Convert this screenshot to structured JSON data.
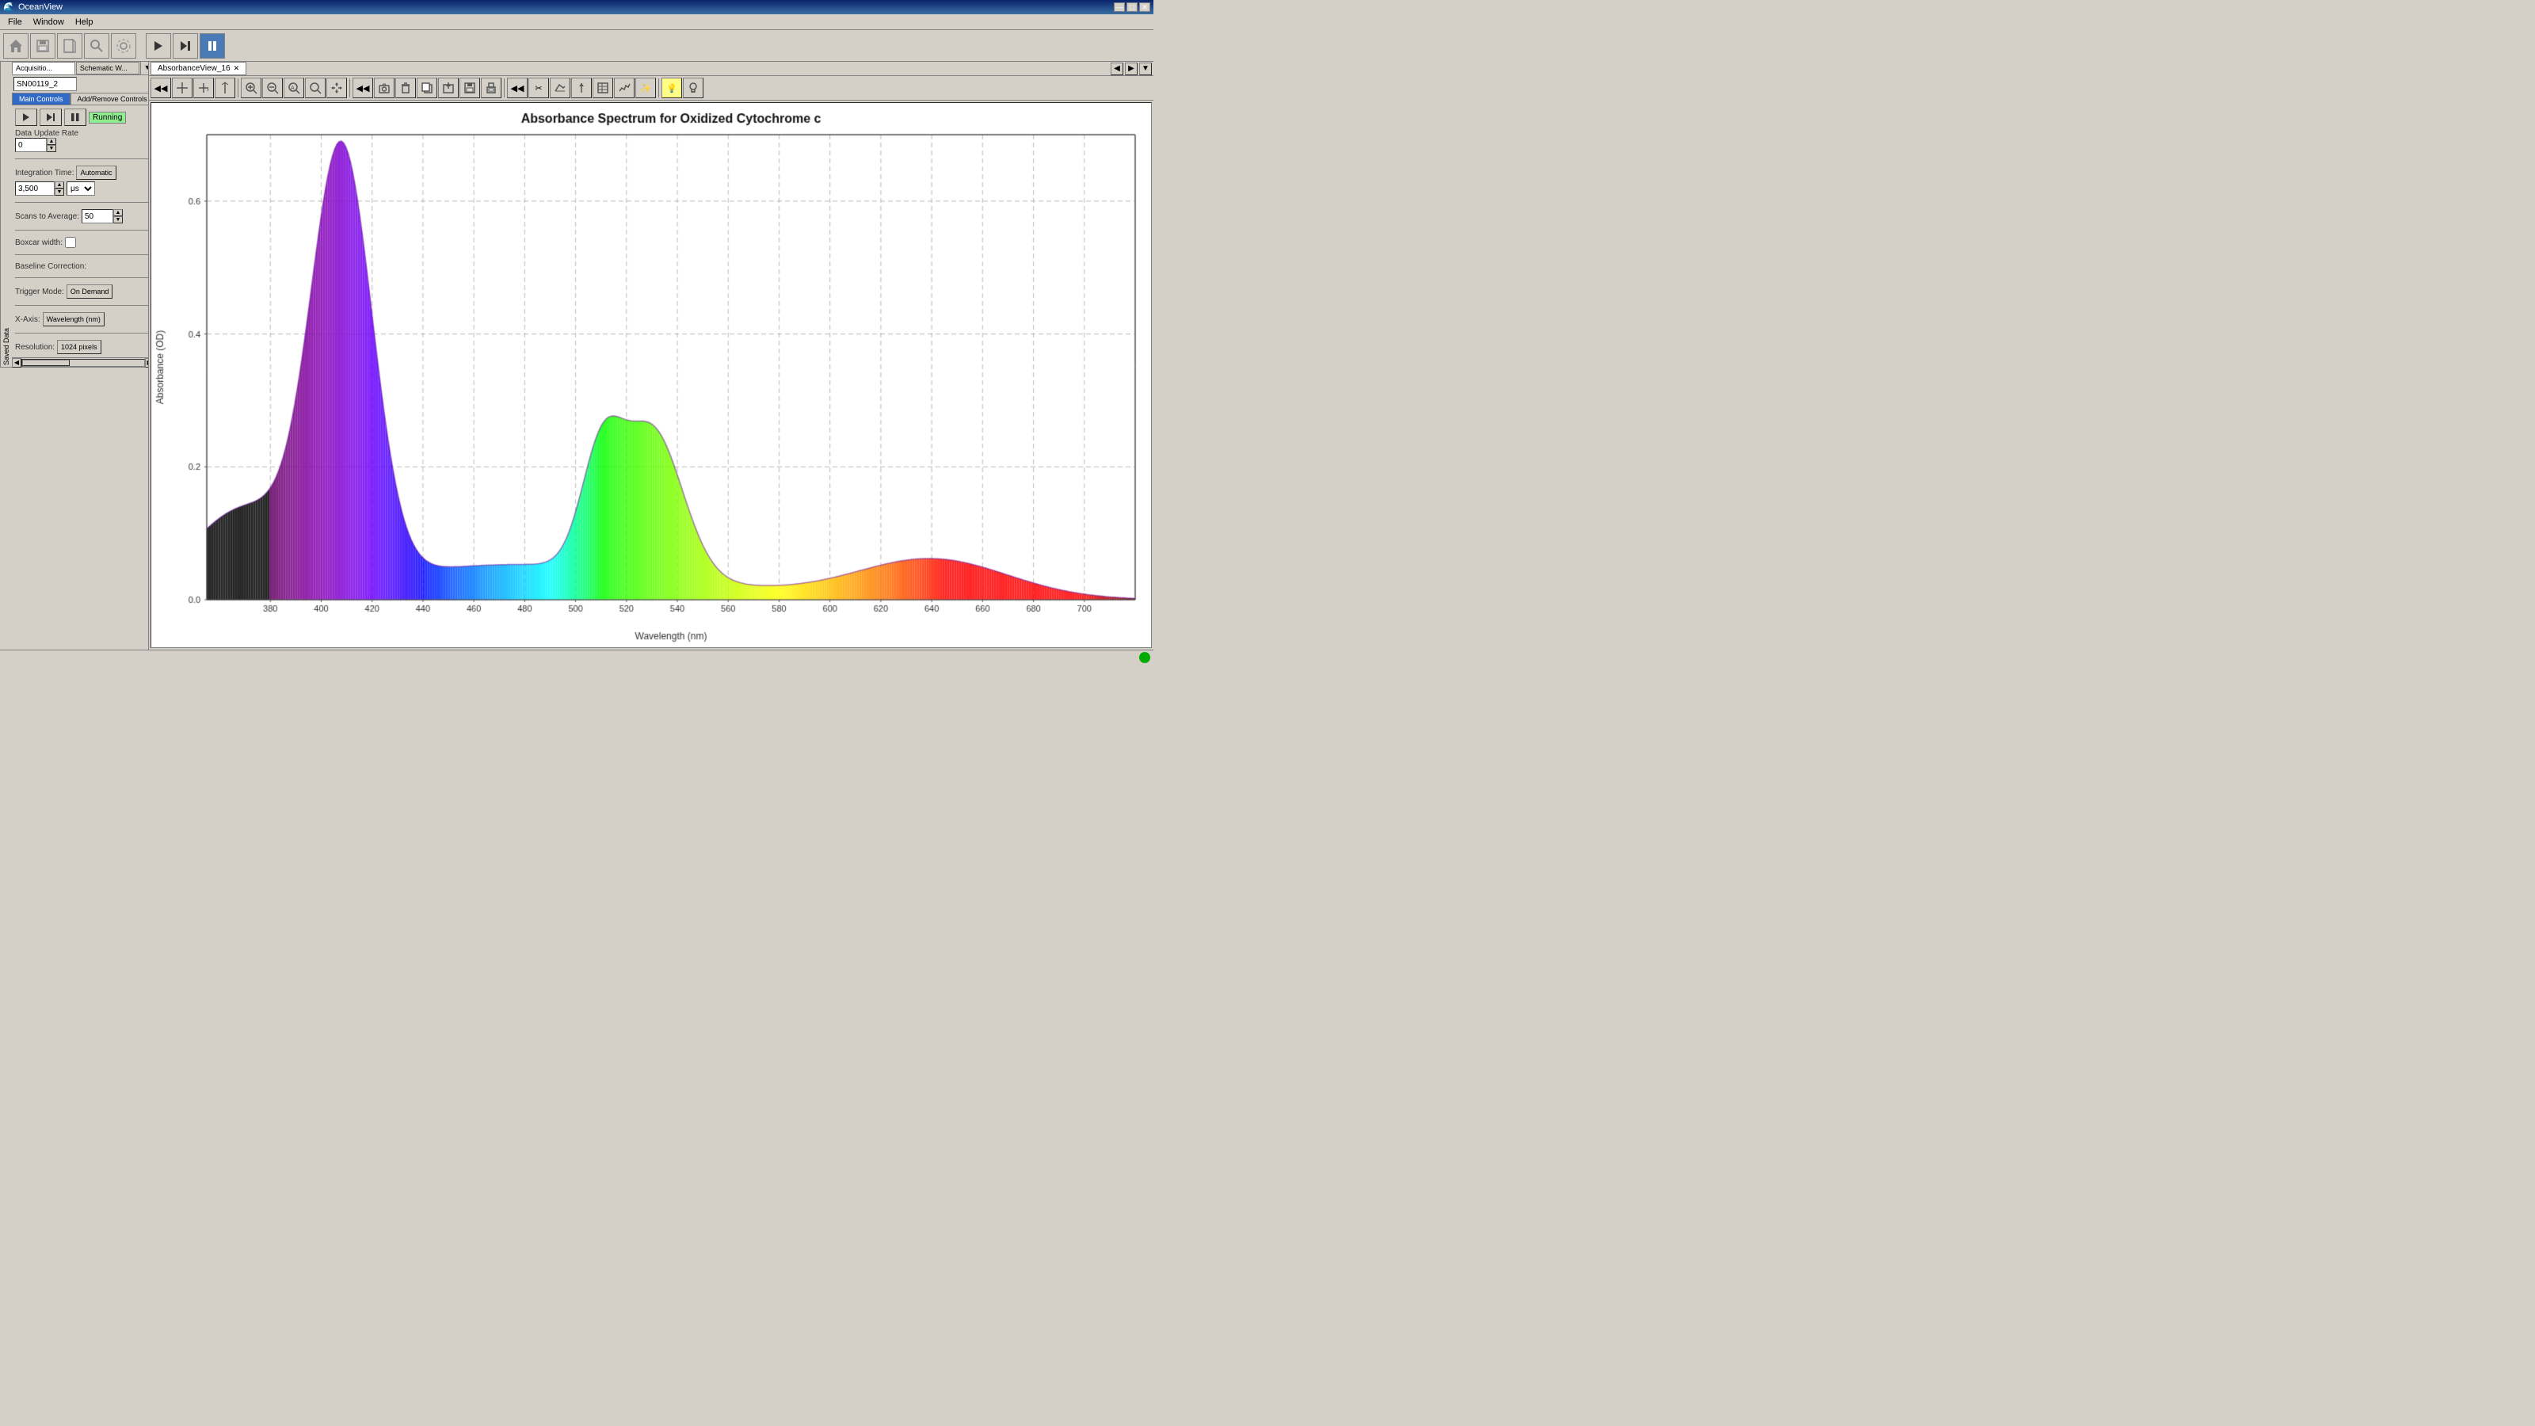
{
  "titleBar": {
    "title": "OceanView",
    "minBtn": "—",
    "maxBtn": "□",
    "closeBtn": "✕"
  },
  "menuBar": {
    "items": [
      "File",
      "Window",
      "Help"
    ]
  },
  "mainToolbar": {
    "buttons": [
      "🏠",
      "💾",
      "⬜",
      "🔍",
      "⬡",
      "▶",
      "⏭",
      "⏸"
    ]
  },
  "leftPanel": {
    "tabs": [
      {
        "label": "Acquisitio...",
        "active": true
      },
      {
        "label": "Schematic W...",
        "active": false
      }
    ],
    "savedDataLabel": "Saved Data",
    "snLabel": "SN00119_2",
    "mainControlsTab": "Main Controls",
    "addRemoveControlsTab": "Add/Remove Controls",
    "controls": {
      "playBtn": "▶",
      "stepBtn": "⏭",
      "pauseBtn": "⏸",
      "runningLabel": "Running",
      "dataUpdateRate": {
        "label": "Data Update Rate",
        "value": "0"
      },
      "integrationTime": {
        "label": "Integration Time:",
        "buttonLabel": "Automatic",
        "value": "3,500",
        "unit": "μs"
      },
      "scansToAverage": {
        "label": "Scans to Average:",
        "value": "50"
      },
      "boxcarWidth": {
        "label": "Boxcar width:",
        "hasCheckbox": true
      },
      "baselineCorrection": {
        "label": "Baseline Correction:"
      },
      "triggerMode": {
        "label": "Trigger Mode:",
        "value": "On Demand"
      },
      "xAxis": {
        "label": "X-Axis:",
        "value": "Wavelength (nm)"
      },
      "resolution": {
        "label": "Resolution:",
        "value": "1024 pixels"
      }
    }
  },
  "docTabs": [
    {
      "label": "AbsorbanceView_16",
      "active": true
    },
    {
      "label": "+",
      "active": false
    }
  ],
  "graphToolbar": {
    "navButtons": [
      "◀◀",
      "✛",
      "+",
      "|"
    ],
    "zoomButtons": [
      "🔍+",
      "🔍-",
      "🔍",
      "🔍all",
      "✋"
    ],
    "navButtons2": [
      "◀◀",
      "📷",
      "🗑",
      "📋",
      "↩",
      "💾",
      "🖨"
    ],
    "analysisButtons": [
      "◀◀",
      "✂",
      "📐",
      "↑",
      "⊞",
      "📈",
      "⚙",
      "💡",
      "🔍💡"
    ]
  },
  "chart": {
    "title": "Absorbance Spectrum for Oxidized Cytochrome c",
    "yAxisLabel": "Absorbance (OD)",
    "xAxisLabel": "Wavelength (nm)",
    "yMin": 0,
    "yMax": 0.6,
    "yTicks": [
      0,
      0.2,
      0.4,
      0.6
    ],
    "xMin": 350,
    "xMax": 720,
    "xTicks": [
      380,
      400,
      420,
      440,
      460,
      480,
      500,
      520,
      540,
      560,
      580,
      600,
      620,
      640,
      660,
      680,
      700
    ]
  },
  "statusBar": {
    "indicator": "green"
  }
}
